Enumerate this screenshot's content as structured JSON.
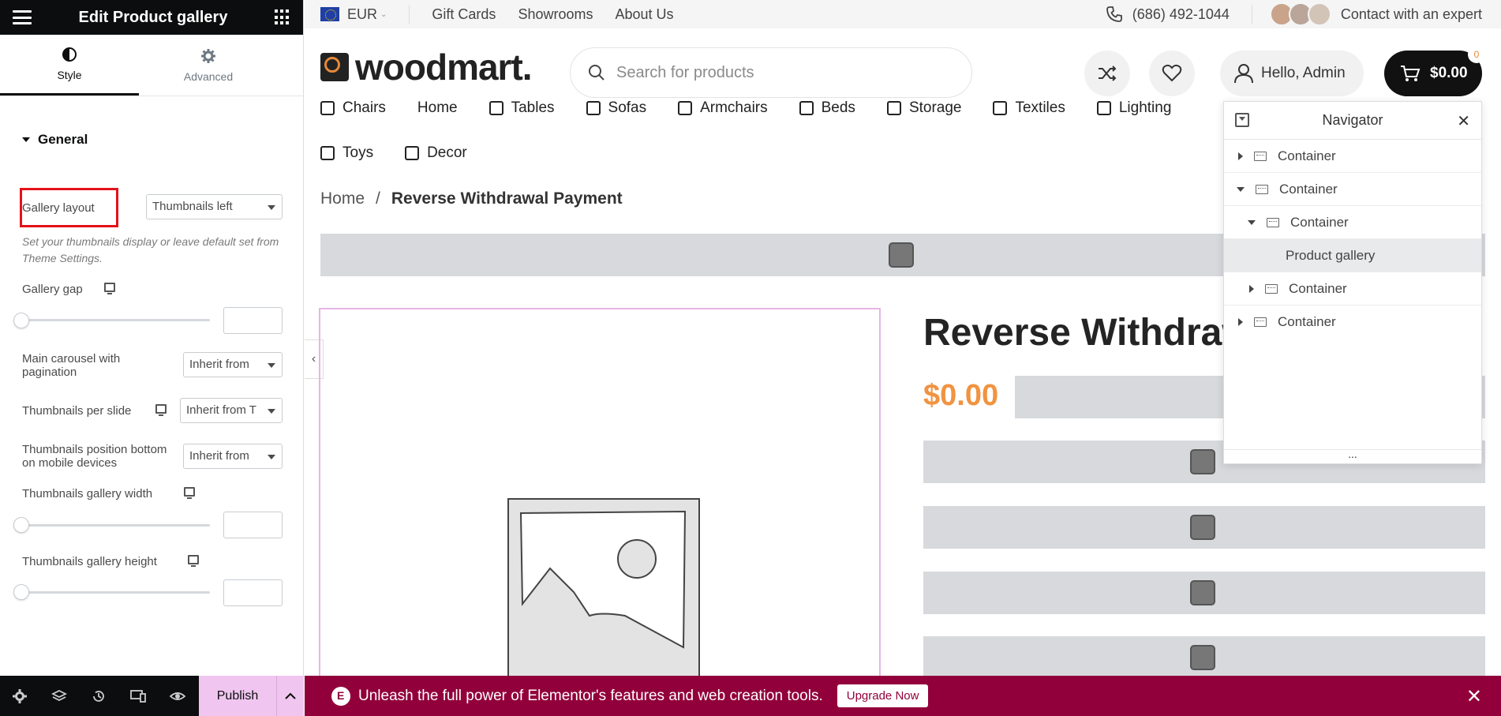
{
  "panel": {
    "title": "Edit Product gallery",
    "tabs": [
      {
        "label": "Style",
        "icon": "contrast-icon",
        "active": true
      },
      {
        "label": "Advanced",
        "icon": "gear-icon",
        "active": false
      }
    ],
    "section": "General",
    "gallery_layout": {
      "label": "Gallery layout",
      "value": "Thumbnails left",
      "help": "Set your thumbnails display or leave default set from Theme Settings."
    },
    "gallery_gap": {
      "label": "Gallery gap",
      "value": ""
    },
    "main_carousel": {
      "label": "Main carousel with pagination",
      "value": "Inherit from"
    },
    "thumbs_per_slide": {
      "label": "Thumbnails per slide",
      "value": "Inherit from T"
    },
    "thumbs_position": {
      "label": "Thumbnails position bottom on mobile devices",
      "value": "Inherit from"
    },
    "thumbs_width": {
      "label": "Thumbnails gallery width",
      "value": ""
    },
    "thumbs_height": {
      "label": "Thumbnails gallery height",
      "value": ""
    },
    "footer": {
      "publish": "Publish"
    }
  },
  "topbar": {
    "currency": "EUR",
    "links": [
      "Gift Cards",
      "Showrooms",
      "About Us"
    ],
    "phone": "(686) 492-1044",
    "contact": "Contact with an expert"
  },
  "header": {
    "logo": "woodmart.",
    "search_placeholder": "Search for products",
    "hello": "Hello, Admin",
    "cart_total": "$0.00",
    "cart_count": "0"
  },
  "nav": {
    "row1": [
      "Chairs",
      "Home",
      "Tables",
      "Sofas",
      "Armchairs",
      "Beds",
      "Storage",
      "Textiles",
      "Lighting"
    ],
    "row2": [
      "Toys",
      "Decor"
    ]
  },
  "breadcrumb": {
    "home": "Home",
    "sep": "/",
    "current": "Reverse Withdrawal Payment"
  },
  "product": {
    "title": "Reverse Withdraw",
    "price": "$0.00"
  },
  "navigator": {
    "title": "Navigator",
    "items": [
      {
        "label": "Container",
        "state": "collapsed",
        "level": 0
      },
      {
        "label": "Container",
        "state": "expanded",
        "level": 0
      },
      {
        "label": "Container",
        "state": "expanded",
        "level": 1
      },
      {
        "label": "Product gallery",
        "state": "selected",
        "level": 2
      },
      {
        "label": "Container",
        "state": "collapsed",
        "level": 1
      },
      {
        "label": "Container",
        "state": "collapsed",
        "level": 0
      }
    ],
    "footer": "..."
  },
  "promo": {
    "text": "Unleash the full power of Elementor's features and web creation tools.",
    "button": "Upgrade Now"
  },
  "colors": {
    "accent_orange": "#f19340",
    "promo_bg": "#92003b",
    "publish_bg": "#f0c6f0",
    "highlight_red": "#e3121a"
  }
}
